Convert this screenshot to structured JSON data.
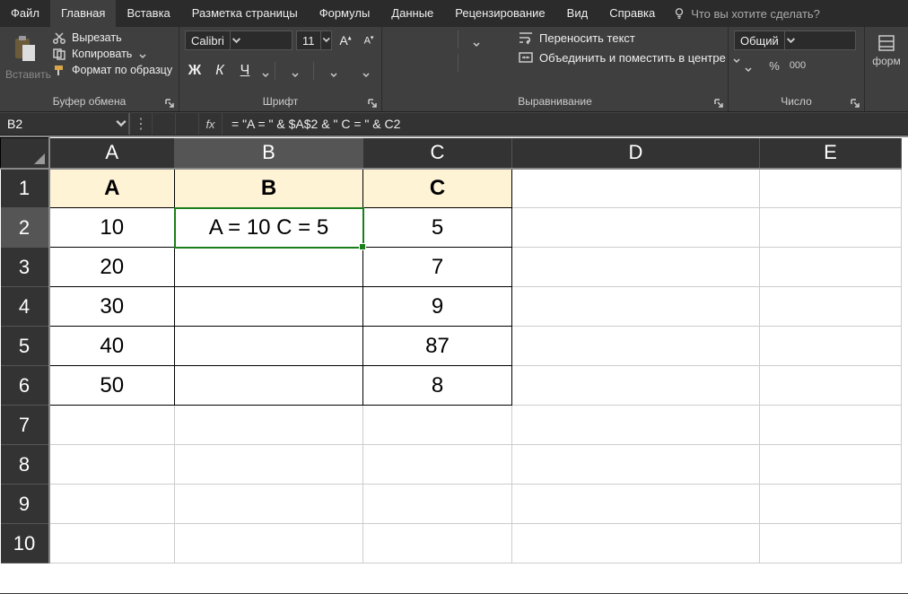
{
  "tabs": {
    "file": "Файл",
    "home": "Главная",
    "insert": "Вставка",
    "pagelayout": "Разметка страницы",
    "formulas": "Формулы",
    "data": "Данные",
    "review": "Рецензирование",
    "view": "Вид",
    "help": "Справка",
    "tellme": "Что вы хотите сделать?"
  },
  "clipboard": {
    "paste": "Вставить",
    "cut": "Вырезать",
    "copy": "Копировать",
    "fmtpaint": "Формат по образцу",
    "group": "Буфер обмена"
  },
  "font": {
    "name": "Calibri",
    "size": "11",
    "group": "Шрифт"
  },
  "align": {
    "wrap": "Переносить текст",
    "merge": "Объединить и поместить в центре",
    "group": "Выравнивание"
  },
  "number": {
    "format": "Общий",
    "group": "Число"
  },
  "format_cut": "форм",
  "namebox": "B2",
  "formula": "= \"A = \" & $A$2 & \" C = \" & C2",
  "cols": {
    "A": "A",
    "B": "B",
    "C": "C",
    "D": "D",
    "E": "E"
  },
  "col_widths": {
    "A": 140,
    "B": 210,
    "C": 166,
    "D": 276,
    "E": 158
  },
  "rows": [
    "1",
    "2",
    "3",
    "4",
    "5",
    "6",
    "7",
    "8",
    "9",
    "10"
  ],
  "data": {
    "r1": {
      "A": "A",
      "B": "B",
      "C": "C"
    },
    "r2": {
      "A": "10",
      "B": "A = 10 C = 5",
      "C": "5"
    },
    "r3": {
      "A": "20",
      "C": "7"
    },
    "r4": {
      "A": "30",
      "C": "9"
    },
    "r5": {
      "A": "40",
      "C": "87"
    },
    "r6": {
      "A": "50",
      "C": "8"
    }
  },
  "selected_cell": "B2"
}
